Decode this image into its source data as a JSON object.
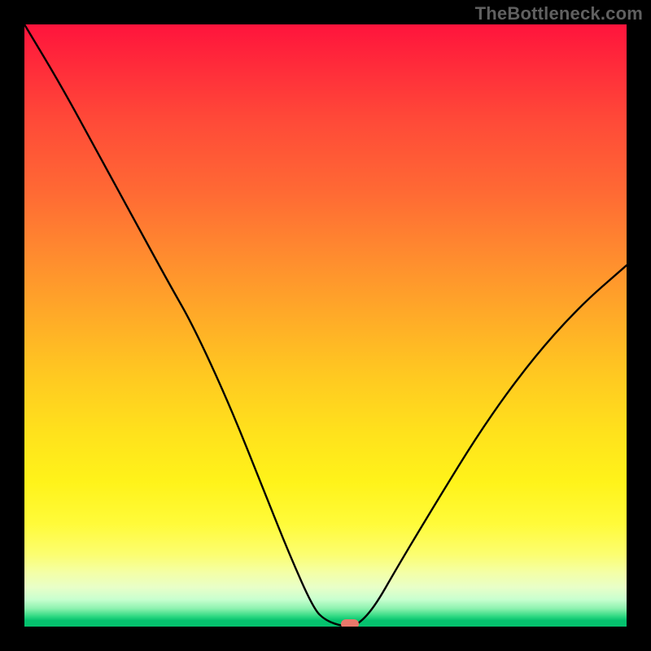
{
  "watermark": "TheBottleneck.com",
  "chart_data": {
    "type": "line",
    "title": "",
    "xlabel": "",
    "ylabel": "",
    "xlim": [
      0,
      100
    ],
    "ylim": [
      0,
      100
    ],
    "background_gradient": {
      "top": "#ff143c",
      "mid_top": "#ff8a2f",
      "mid": "#ffe21c",
      "mid_bottom": "#f4ffa6",
      "bottom": "#05c26e"
    },
    "series": [
      {
        "name": "bottleneck-curve",
        "x": [
          0,
          6,
          12,
          18,
          24,
          28,
          34,
          40,
          44,
          48,
          50,
          53,
          55,
          58,
          62,
          68,
          76,
          84,
          92,
          100
        ],
        "values": [
          100,
          90,
          79,
          68,
          57,
          50,
          37,
          22,
          12,
          3,
          1,
          0,
          0,
          3,
          10,
          20,
          33,
          44,
          53,
          60
        ]
      }
    ],
    "minimum_marker": {
      "x": 54,
      "y": 0.4,
      "color": "#e8786b"
    },
    "annotations": []
  }
}
